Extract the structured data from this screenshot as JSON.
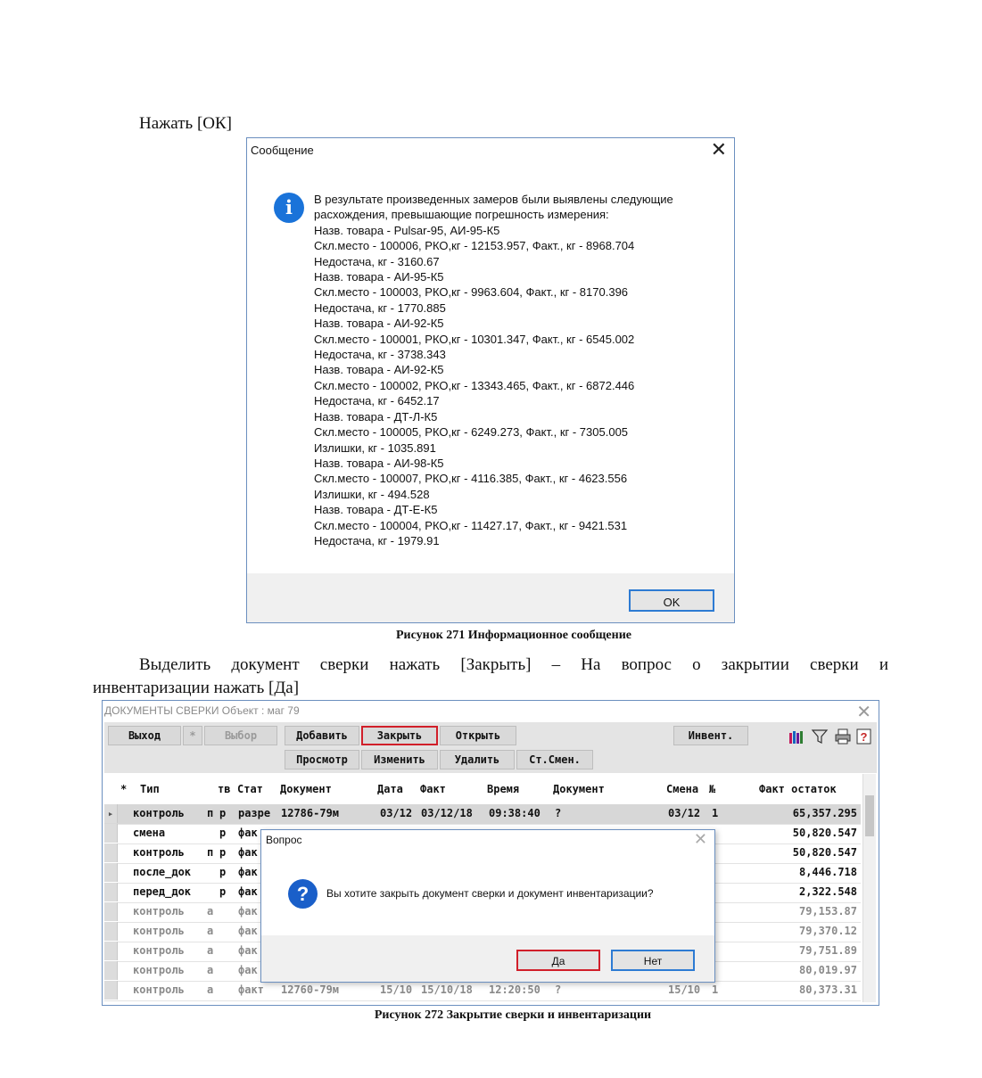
{
  "texts": {
    "press_ok": "Нажать [ОК]",
    "caption_271": "Рисунок 271 Информационное сообщение",
    "instruction_line1": "Выделить документ сверки нажать [Закрыть] – На вопрос о закрытии сверки и",
    "instruction_line2": "инвентаризации нажать [Да]",
    "caption_272": "Рисунок 272 Закрытие сверки и инвентаризации"
  },
  "message_dialog": {
    "title": "Сообщение",
    "close": "✕",
    "icon": "info-icon",
    "icon_glyph": "i",
    "lines": [
      "В результате произведенных замеров были выявлены следующие",
      "расхождения, превышающие погрешность измерения:",
      "Назв. товара - Pulsar-95, АИ-95-К5",
      "Скл.место - 100006, РКО,кг - 12153.957, Факт., кг - 8968.704",
      "Недостача, кг - 3160.67",
      "Назв. товара - АИ-95-К5",
      "Скл.место - 100003, РКО,кг - 9963.604, Факт., кг - 8170.396",
      "Недостача, кг - 1770.885",
      "Назв. товара - АИ-92-К5",
      "Скл.место - 100001, РКО,кг - 10301.347, Факт., кг - 6545.002",
      "Недостача, кг - 3738.343",
      "Назв. товара - АИ-92-К5",
      "Скл.место - 100002, РКО,кг - 13343.465, Факт., кг - 6872.446",
      "Недостача, кг - 6452.17",
      "Назв. товара - ДТ-Л-К5",
      "Скл.место - 100005, РКО,кг - 6249.273, Факт., кг - 7305.005",
      "Излишки, кг - 1035.891",
      "Назв. товара - АИ-98-К5",
      "Скл.место - 100007, РКО,кг - 4116.385, Факт., кг - 4623.556",
      "Излишки, кг - 494.528",
      "Назв. товара - ДТ-Е-К5",
      "Скл.место - 100004, РКО,кг - 11427.17, Факт., кг - 9421.531",
      "Недостача, кг - 1979.91"
    ],
    "ok_label": "OK"
  },
  "doc_window": {
    "title": "ДОКУМЕНТЫ СВЕРКИ Объект : маг 79",
    "close": "✕",
    "buttons": {
      "exit": "Выход",
      "star": "*",
      "select": "Выбор",
      "add": "Добавить",
      "close_doc": "Закрыть",
      "open": "Открыть",
      "invent": "Инвент.",
      "view": "Просмотр",
      "edit": "Изменить",
      "delete": "Удалить",
      "shift": "Ст.Смен."
    },
    "tool_icons": [
      "bottles-icon",
      "filter-icon",
      "printer-icon",
      "help-icon"
    ],
    "columns": [
      "*",
      "Тип",
      "тв",
      "Стат",
      "Документ",
      "Дата",
      "Факт",
      "Время",
      "Документ",
      "Смена",
      "№",
      "Факт остаток"
    ],
    "rows": [
      {
        "type": "контроль",
        "tv": "п",
        "r": "р",
        "stat": "разре",
        "doc": "12786-79м",
        "date": "03/12",
        "fact": "03/12/18",
        "time": "09:38:40",
        "doc2": "?",
        "shift": "03/12",
        "num": "1",
        "rest": "65,357.295"
      },
      {
        "type": "смена",
        "tv": "",
        "r": "р",
        "stat": "фак",
        "doc": "",
        "date": "",
        "fact": "",
        "time": "",
        "doc2": "",
        "shift": "",
        "num": "",
        "rest": "50,820.547"
      },
      {
        "type": "контроль",
        "tv": "п",
        "r": "р",
        "stat": "фак",
        "doc": "",
        "date": "",
        "fact": "",
        "time": "",
        "doc2": "",
        "shift": "",
        "num": "",
        "rest": "50,820.547"
      },
      {
        "type": "после_док",
        "tv": "",
        "r": "р",
        "stat": "фак",
        "doc": "",
        "date": "",
        "fact": "",
        "time": "",
        "doc2": "",
        "shift": "",
        "num": "",
        "rest": "8,446.718"
      },
      {
        "type": "перед_док",
        "tv": "",
        "r": "р",
        "stat": "фак",
        "doc": "",
        "date": "",
        "fact": "",
        "time": "",
        "doc2": "",
        "shift": "",
        "num": "",
        "rest": "2,322.548"
      },
      {
        "type": "контроль",
        "tv": "а",
        "r": "",
        "stat": "фак",
        "doc": "",
        "date": "",
        "fact": "",
        "time": "",
        "doc2": "",
        "shift": "",
        "num": "",
        "rest": "79,153.87"
      },
      {
        "type": "контроль",
        "tv": "а",
        "r": "",
        "stat": "фак",
        "doc": "",
        "date": "",
        "fact": "",
        "time": "",
        "doc2": "",
        "shift": "",
        "num": "",
        "rest": "79,370.12"
      },
      {
        "type": "контроль",
        "tv": "а",
        "r": "",
        "stat": "фак",
        "doc": "",
        "date": "",
        "fact": "",
        "time": "",
        "doc2": "",
        "shift": "",
        "num": "",
        "rest": "79,751.89"
      },
      {
        "type": "контроль",
        "tv": "а",
        "r": "",
        "stat": "фак",
        "doc": "",
        "date": "",
        "fact": "",
        "time": "",
        "doc2": "",
        "shift": "",
        "num": "",
        "rest": "80,019.97"
      },
      {
        "type": "контроль",
        "tv": "а",
        "r": "",
        "stat": "факт",
        "doc": "12760-79м",
        "date": "15/10",
        "fact": "15/10/18",
        "time": "12:20:50",
        "doc2": "?",
        "shift": "15/10",
        "num": "1",
        "rest": "80,373.31"
      }
    ]
  },
  "question_dialog": {
    "title": "Вопрос",
    "close": "✕",
    "icon": "question-icon",
    "icon_glyph": "?",
    "text": "Вы хотите закрыть документ сверки и документ инвентаризации?",
    "yes_label": "Да",
    "no_label": "Нет"
  },
  "colors": {
    "highlight_red": "#d11f2a",
    "focus_blue": "#2d7bd3",
    "info_blue": "#1a73d9"
  }
}
